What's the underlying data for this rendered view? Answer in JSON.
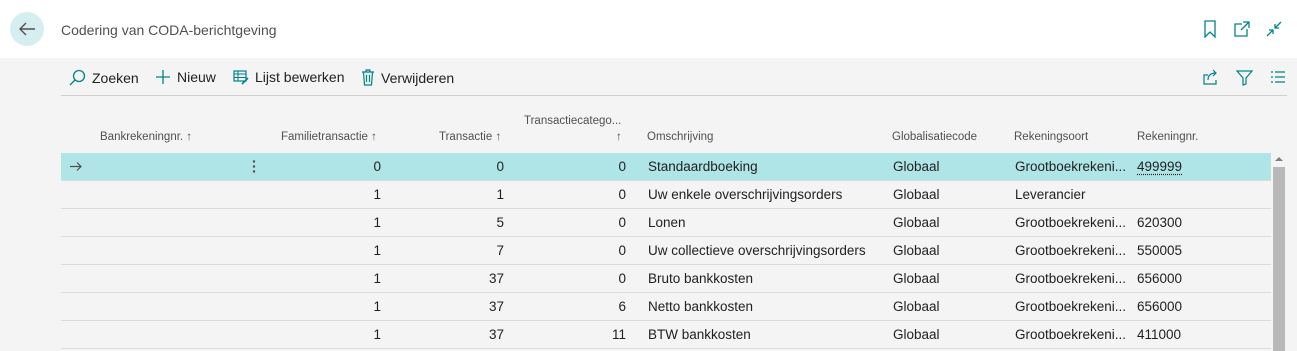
{
  "window": {
    "title": "Codering van CODA-berichtgeving",
    "icons": [
      "bookmark-icon",
      "open-new-window-icon",
      "collapse-icon"
    ]
  },
  "actions": {
    "search": "Zoeken",
    "new": "Nieuw",
    "edit_list": "Lijst bewerken",
    "delete": "Verwijderen",
    "right_icons": [
      "share-icon",
      "filter-icon",
      "list-view-icon"
    ]
  },
  "columns": {
    "bank_account": "Bankrekeningnr. ↑",
    "transaction_family": "Familietransactie ↑",
    "transaction": "Transactie ↑",
    "transaction_category": "Transactiecatego...",
    "transaction_category_sort": "↑",
    "description": "Omschrijving",
    "globalisation_code": "Globalisatiecode",
    "account_type": "Rekeningsoort",
    "account_no": "Rekeningnr."
  },
  "rows": [
    {
      "bank_account": "",
      "family": "0",
      "transaction": "0",
      "category": "0",
      "description": "Standaardboeking",
      "globalisation": "Globaal",
      "account_type": "Grootboekrekeni...",
      "account_no": "499999"
    },
    {
      "bank_account": "",
      "family": "1",
      "transaction": "1",
      "category": "0",
      "description": "Uw enkele overschrijvingsorders",
      "globalisation": "Globaal",
      "account_type": "Leverancier",
      "account_no": ""
    },
    {
      "bank_account": "",
      "family": "1",
      "transaction": "5",
      "category": "0",
      "description": "Lonen",
      "globalisation": "Globaal",
      "account_type": "Grootboekrekeni...",
      "account_no": "620300"
    },
    {
      "bank_account": "",
      "family": "1",
      "transaction": "7",
      "category": "0",
      "description": "Uw collectieve overschrijvingsorders",
      "globalisation": "Globaal",
      "account_type": "Grootboekrekeni...",
      "account_no": "550005"
    },
    {
      "bank_account": "",
      "family": "1",
      "transaction": "37",
      "category": "0",
      "description": "Bruto bankkosten",
      "globalisation": "Globaal",
      "account_type": "Grootboekrekeni...",
      "account_no": "656000"
    },
    {
      "bank_account": "",
      "family": "1",
      "transaction": "37",
      "category": "6",
      "description": "Netto bankkosten",
      "globalisation": "Globaal",
      "account_type": "Grootboekrekeni...",
      "account_no": "656000"
    },
    {
      "bank_account": "",
      "family": "1",
      "transaction": "37",
      "category": "11",
      "description": "BTW bankkosten",
      "globalisation": "Globaal",
      "account_type": "Grootboekrekeni...",
      "account_no": "411000"
    }
  ],
  "colors": {
    "accent": "#008489",
    "selected_row": "#b0e5e7",
    "back_button_bg": "#d7eef0"
  }
}
